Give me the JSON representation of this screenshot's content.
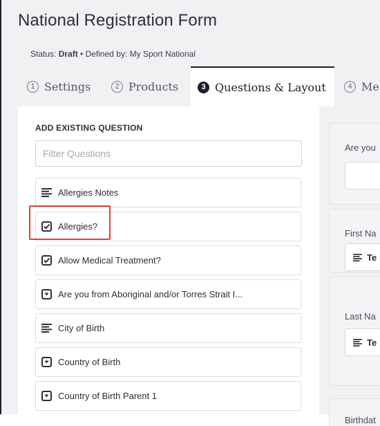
{
  "page": {
    "title": "National Registration Form",
    "status_label": "Status: ",
    "status_value": "Draft",
    "defined_by": " • Defined by: My Sport National"
  },
  "tabs": [
    {
      "num": "1",
      "label": "Settings",
      "active": false
    },
    {
      "num": "2",
      "label": "Products",
      "active": false
    },
    {
      "num": "3",
      "label": "Questions & Layout",
      "active": true
    },
    {
      "num": "4",
      "label": "Me",
      "active": false
    }
  ],
  "left_panel": {
    "section_title": "ADD EXISTING QUESTION",
    "filter_placeholder": "Filter Questions",
    "questions": [
      {
        "label": "Allergies Notes",
        "icon": "text-lines-icon"
      },
      {
        "label": "Allergies?",
        "icon": "checkbox-icon"
      },
      {
        "label": "Allow Medical Treatment?",
        "icon": "checkbox-icon"
      },
      {
        "label": "Are you from Aboriginal and/or Torres Strait I...",
        "icon": "dropdown-icon"
      },
      {
        "label": "City of Birth",
        "icon": "text-lines-icon"
      },
      {
        "label": "Country of Birth",
        "icon": "dropdown-icon"
      },
      {
        "label": "Country of Birth Parent 1",
        "icon": "dropdown-icon"
      }
    ]
  },
  "right_panel": {
    "cards": [
      {
        "label": "Are you",
        "field_text": ""
      },
      {
        "label": "First Na",
        "field_text": "Te"
      },
      {
        "label": "Last Na",
        "field_text": "Te"
      },
      {
        "label": "Birthdat",
        "field_text": ""
      }
    ]
  },
  "colors": {
    "highlight": "#e0413a",
    "accent_dark": "#1e1e2e"
  }
}
